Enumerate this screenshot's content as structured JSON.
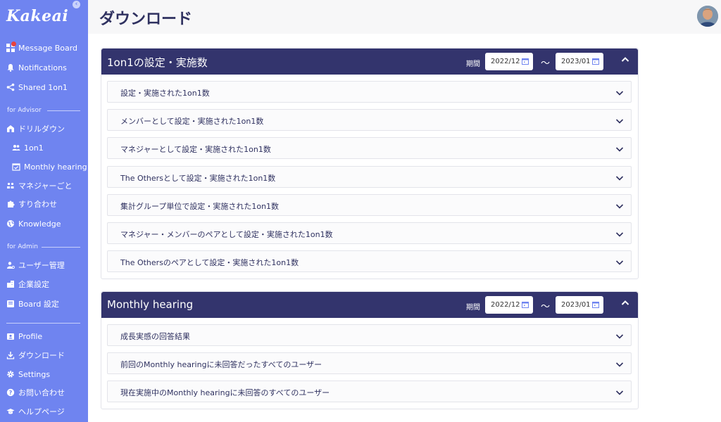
{
  "sidebar": {
    "logo": "Kakeai",
    "items": [
      {
        "label": "Message Board",
        "icon": "dashboard-icon"
      },
      {
        "label": "Notifications",
        "icon": "bell-icon"
      },
      {
        "label": "Shared 1on1",
        "icon": "share-icon"
      }
    ],
    "advisor_label": "for Advisor",
    "advisor_items": [
      {
        "label": "ドリルダウン",
        "icon": "drilldown-icon"
      },
      {
        "label": "1on1",
        "icon": "people-icon"
      },
      {
        "label": "Monthly hearing",
        "icon": "calendar-check-icon"
      },
      {
        "label": "マネジャーごと",
        "icon": "manager-icon"
      },
      {
        "label": "すり合わせ",
        "icon": "puzzle-icon"
      },
      {
        "label": "Knowledge",
        "icon": "globe-icon"
      }
    ],
    "admin_label": "for Admin",
    "admin_items": [
      {
        "label": "ユーザー管理",
        "icon": "user-manage-icon"
      },
      {
        "label": "企業設定",
        "icon": "company-icon"
      },
      {
        "label": "Board 設定",
        "icon": "board-icon"
      }
    ],
    "bottom_items": [
      {
        "label": "Profile",
        "icon": "profile-icon"
      },
      {
        "label": "ダウンロード",
        "icon": "download-icon"
      },
      {
        "label": "Settings",
        "icon": "gear-icon"
      },
      {
        "label": "お問い合わせ",
        "icon": "help-icon"
      },
      {
        "label": "ヘルプページ",
        "icon": "graduation-icon"
      }
    ]
  },
  "header": {
    "title": "ダウンロード"
  },
  "sections": [
    {
      "title": "1on1の設定・実施数",
      "period_label": "期間",
      "date_from": "2022/12",
      "date_to": "2023/01",
      "tilde": "〜",
      "rows": [
        "設定・実施された1on1数",
        "メンバーとして設定・実施された1on1数",
        "マネジャーとして設定・実施された1on1数",
        "The Othersとして設定・実施された1on1数",
        "集計グループ単位で設定・実施された1on1数",
        "マネジャー・メンバーのペアとして設定・実施された1on1数",
        "The Othersのペアとして設定・実施された1on1数"
      ]
    },
    {
      "title": "Monthly hearing",
      "period_label": "期間",
      "date_from": "2022/12",
      "date_to": "2023/01",
      "tilde": "〜",
      "rows": [
        "成長実感の回答結果",
        "前回のMonthly hearingに未回答だったすべてのユーザー",
        "現在実施中のMonthly hearingに未回答のすべてのユーザー"
      ]
    }
  ],
  "colors": {
    "sidebar": "#6f84f0",
    "card_header": "#33346d",
    "badge": "#e8423f"
  }
}
